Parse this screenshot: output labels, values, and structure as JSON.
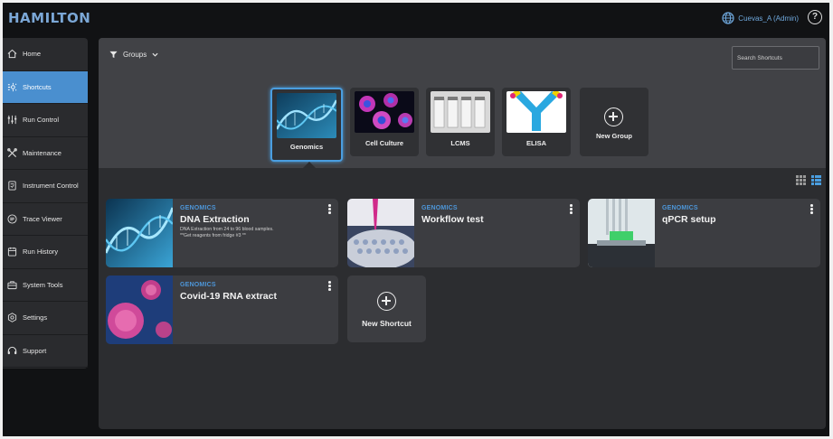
{
  "app": {
    "logo": "HAMILTON"
  },
  "user": {
    "name": "Cuevas_A (Admin)",
    "help": "?"
  },
  "sidebar": {
    "items": [
      {
        "label": "Home",
        "icon": "home-icon",
        "active": false
      },
      {
        "label": "Shortcuts",
        "icon": "shortcuts-icon",
        "active": true
      },
      {
        "label": "Run Control",
        "icon": "sliders-icon",
        "active": false
      },
      {
        "label": "Maintenance",
        "icon": "tools-icon",
        "active": false
      },
      {
        "label": "Instrument Control",
        "icon": "instrument-icon",
        "active": false
      },
      {
        "label": "Trace Viewer",
        "icon": "trace-icon",
        "active": false
      },
      {
        "label": "Run History",
        "icon": "history-icon",
        "active": false
      },
      {
        "label": "System Tools",
        "icon": "toolbox-icon",
        "active": false
      },
      {
        "label": "Settings",
        "icon": "settings-icon",
        "active": false
      },
      {
        "label": "Support",
        "icon": "headset-icon",
        "active": false
      }
    ]
  },
  "filter": {
    "label": "Groups"
  },
  "search": {
    "placeholder": "Search Shortcuts"
  },
  "groups": [
    {
      "label": "Genomics",
      "selected": true
    },
    {
      "label": "Cell Culture",
      "selected": false
    },
    {
      "label": "LCMS",
      "selected": false
    },
    {
      "label": "ELISA",
      "selected": false
    },
    {
      "label": "New Group",
      "selected": false
    }
  ],
  "shortcuts": [
    {
      "group": "GENOMICS",
      "title": "DNA Extraction",
      "desc1": "DNA Extraction from 24 to 96 blood samples.",
      "desc2": "**Get reagents from fridge #3 **"
    },
    {
      "group": "GENOMICS",
      "title": "Workflow test",
      "desc1": "",
      "desc2": ""
    },
    {
      "group": "GENOMICS",
      "title": "qPCR setup",
      "desc1": "",
      "desc2": ""
    },
    {
      "group": "GENOMICS",
      "title": "Covid-19 RNA extract",
      "desc1": "",
      "desc2": ""
    }
  ],
  "new_shortcut": {
    "label": "New Shortcut"
  },
  "colors": {
    "accent": "#4a8fcf",
    "group_text": "#4d96d9",
    "background": "#111214"
  }
}
